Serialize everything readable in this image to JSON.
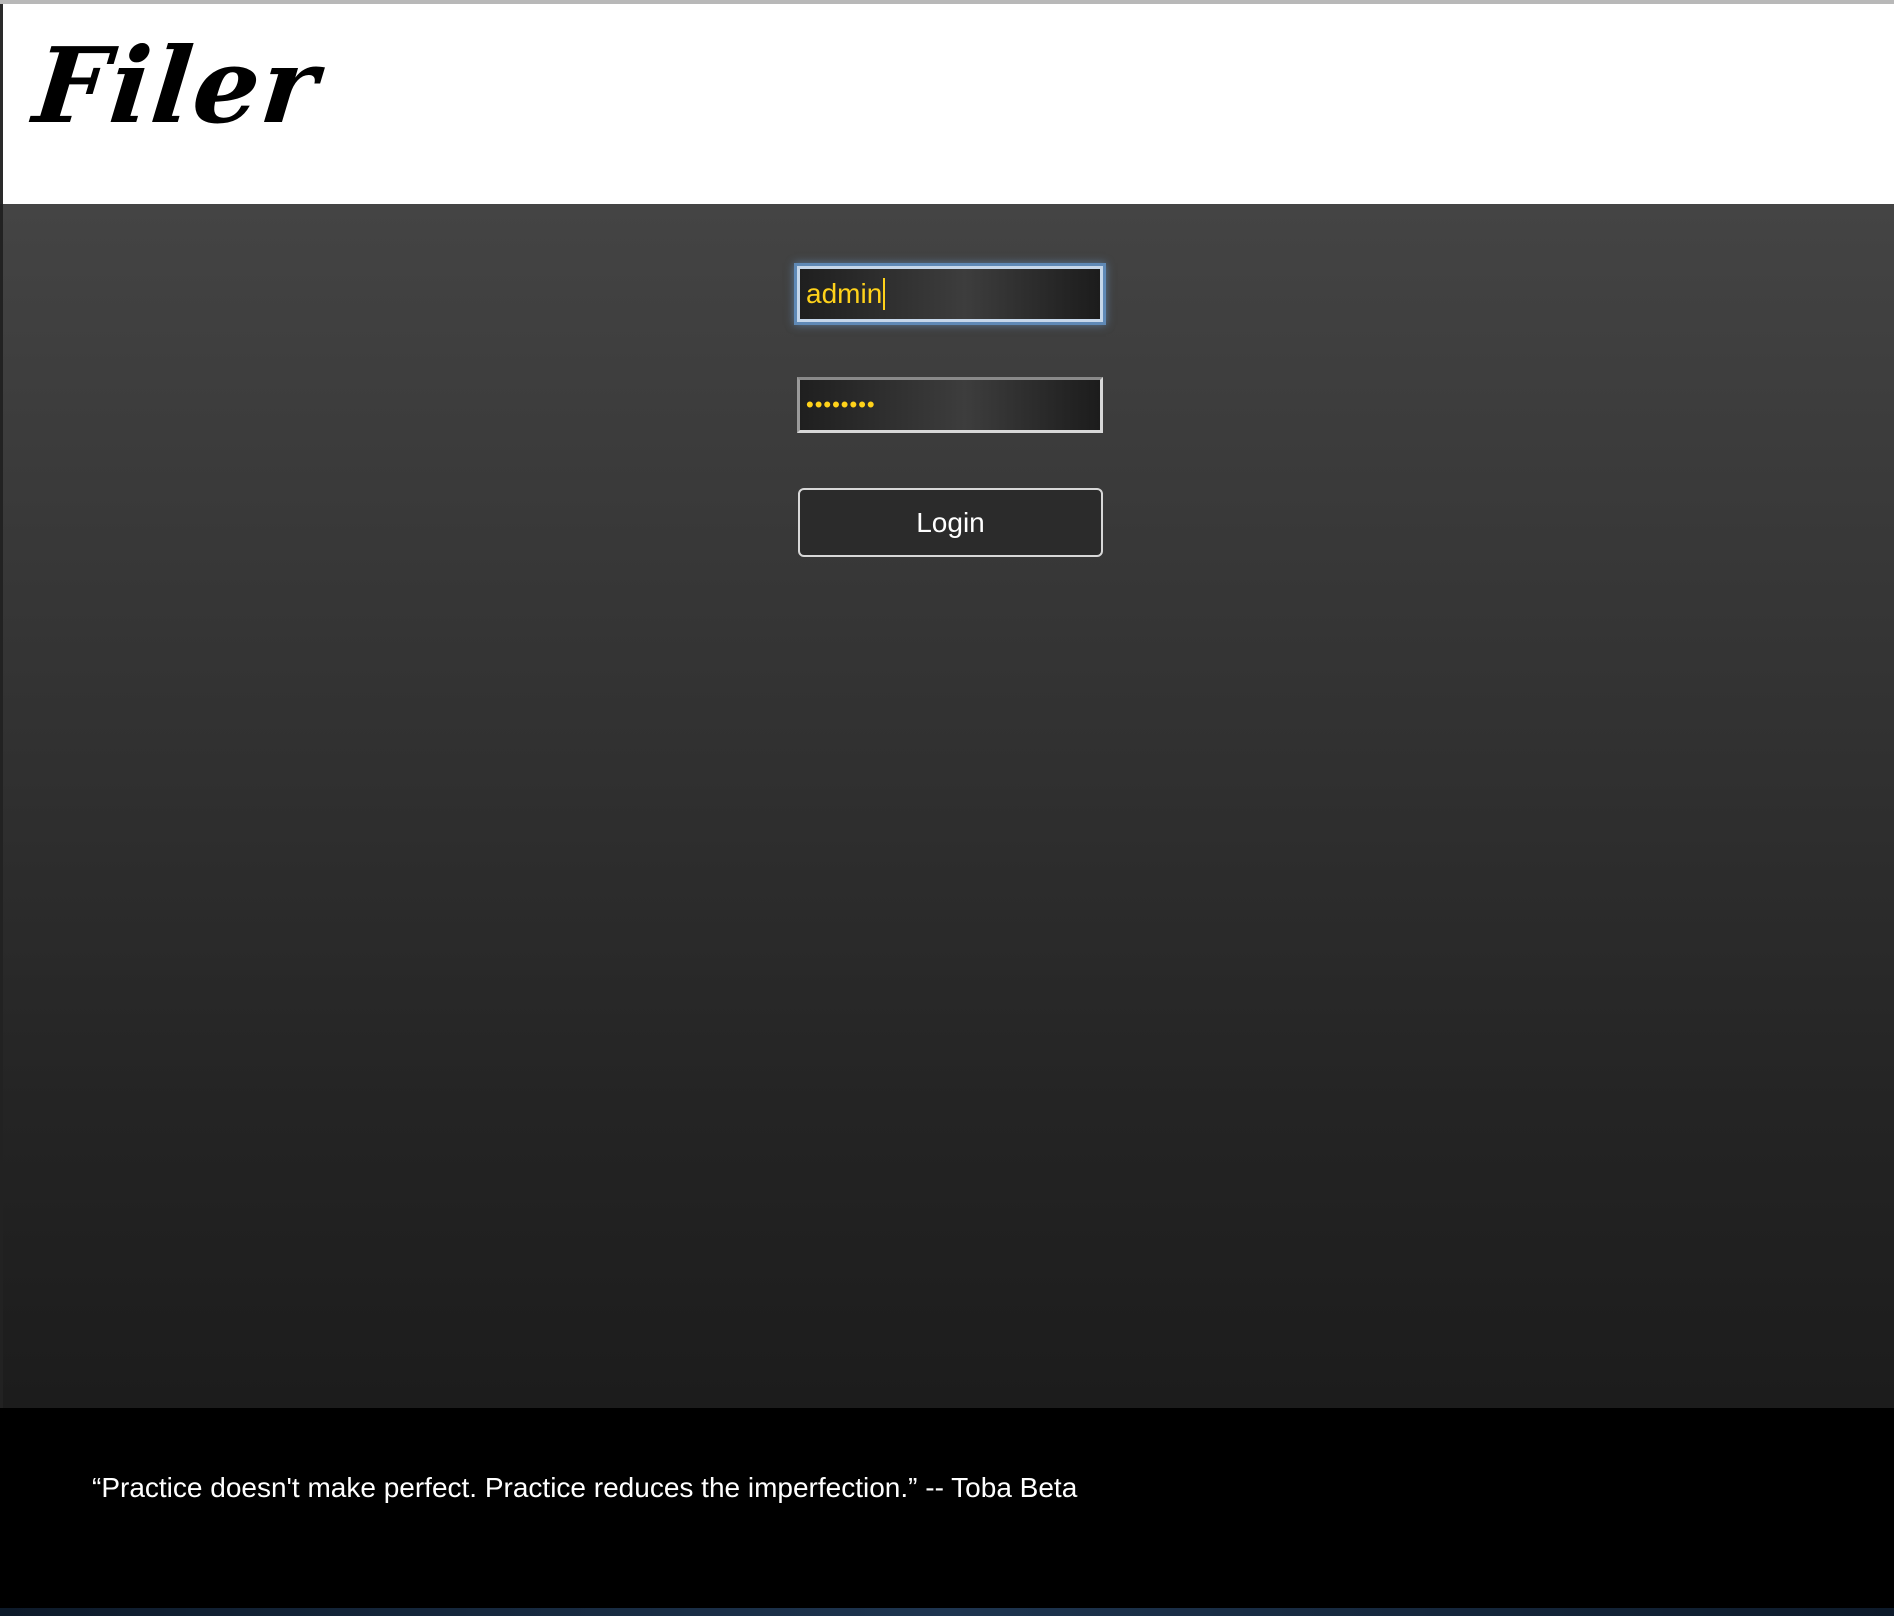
{
  "app": {
    "logo_text": "Filer"
  },
  "login_form": {
    "username_value": "admin",
    "password_mask": "••••••••",
    "login_label": "Login"
  },
  "footer": {
    "quote": "“Practice doesn't make perfect. Practice reduces the imperfection.” -- Toba Beta"
  },
  "colors": {
    "input_text": "#ffd21a",
    "focus_ring": "#5f89b6",
    "footer_bg": "#000000",
    "header_bg": "#ffffff"
  }
}
